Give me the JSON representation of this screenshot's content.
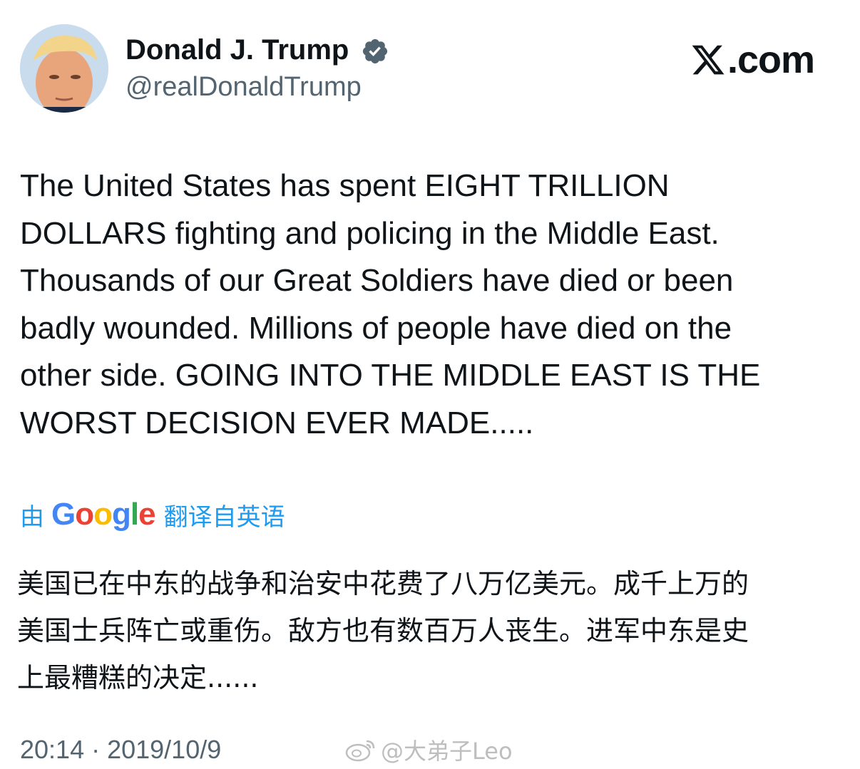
{
  "header": {
    "display_name": "Donald J. Trump",
    "handle": "@realDonaldTrump",
    "verified": true,
    "site": "X.com"
  },
  "tweet": {
    "text": "The United States has spent EIGHT TRILLION\nDOLLARS fighting and policing in the Middle East.\nThousands of our Great Soldiers have died or been\nbadly wounded. Millions of people have died on the\nother side. GOING INTO THE MIDDLE EAST IS THE\nWORST DECISION EVER MADE.....",
    "translation_prefix": "由",
    "translation_provider": "Google",
    "translation_suffix": "翻译自英语",
    "translated_text": "美国已在中东的战争和治安中花费了八万亿美元。成千上万的\n美国士兵阵亡或重伤。敌方也有数百万人丧生。进军中东是史\n上最糟糕的决定......",
    "timestamp": "20:14 · 2019/10/9"
  },
  "watermark": {
    "text": "@大弟子Leo"
  },
  "colors": {
    "text": "#0f1419",
    "secondary_text": "#536471",
    "link_blue": "#1d9bf0",
    "verified_badge": "#536471"
  }
}
